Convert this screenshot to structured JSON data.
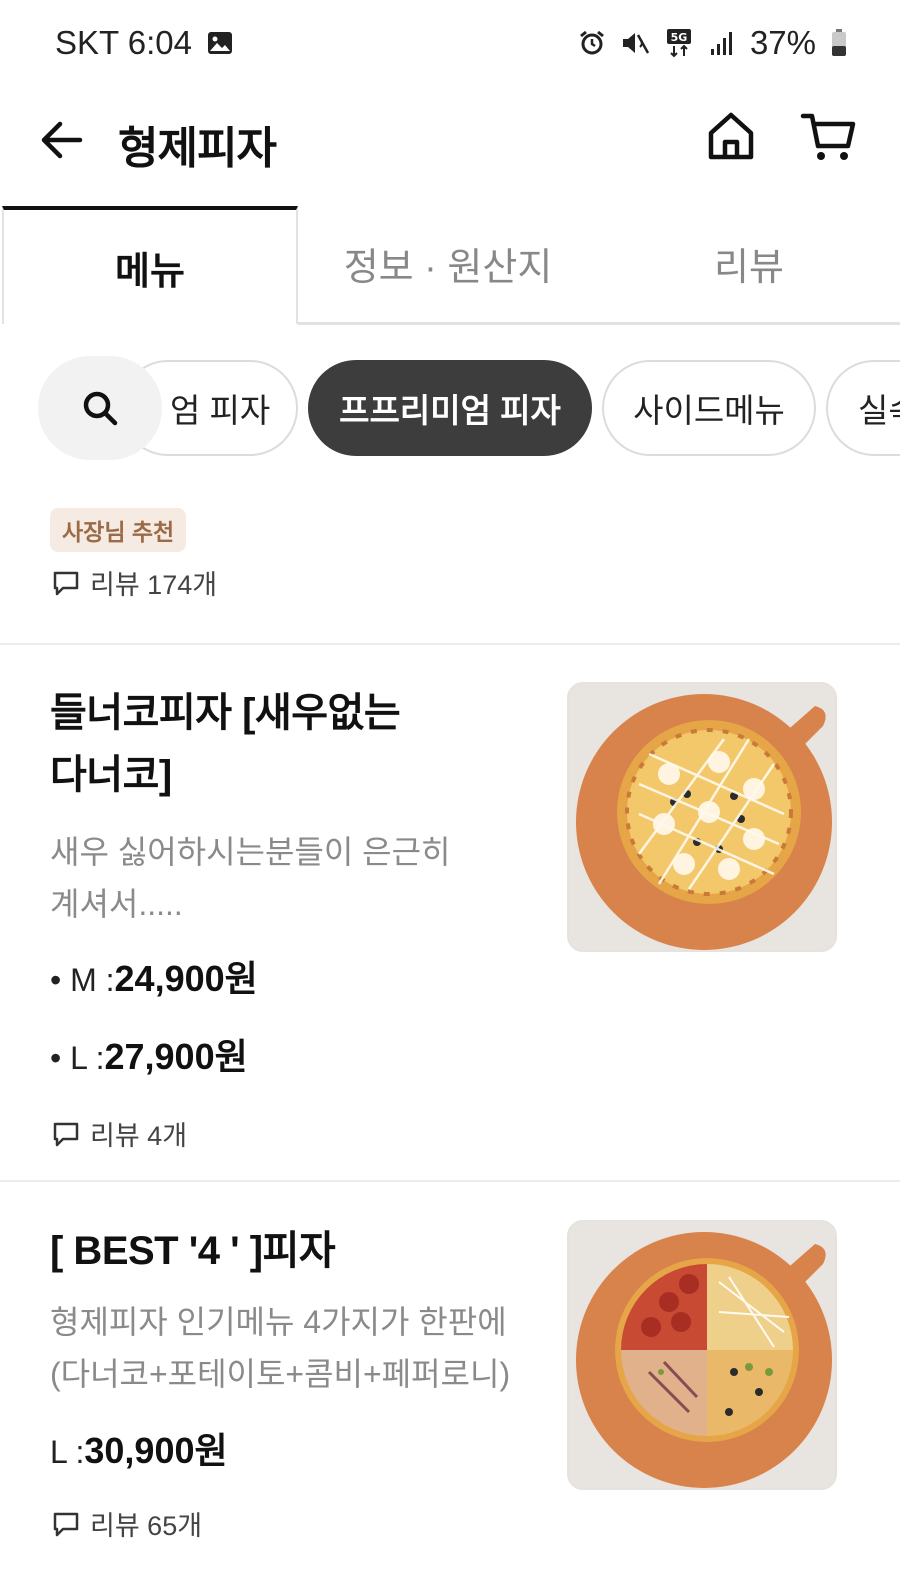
{
  "status_bar": {
    "carrier_time": "SKT 6:04",
    "battery": "37%",
    "icons": [
      "gallery-icon",
      "alarm-icon",
      "mute-icon",
      "5g-icon",
      "signal-icon",
      "battery-icon"
    ]
  },
  "app_bar": {
    "title": "형제피자",
    "icons": [
      "back-arrow-icon",
      "home-icon",
      "cart-icon"
    ]
  },
  "tabs": [
    {
      "label": "메뉴",
      "active": true
    },
    {
      "label": "정보 · 원산지",
      "active": false
    },
    {
      "label": "리뷰",
      "active": false
    }
  ],
  "chips": {
    "search_icon": "search-icon",
    "items": [
      {
        "label": "엄 피자",
        "active": false
      },
      {
        "label": "프프리미엄 피자",
        "active": true
      },
      {
        "label": "사이드메뉴",
        "active": false
      },
      {
        "label": "실속",
        "active": false
      }
    ]
  },
  "top_section": {
    "badge": "사장님 추천",
    "review": "리뷰 174개"
  },
  "menu_items": [
    {
      "name_line1": "들너코피자 [새우없는",
      "name_line2": "다너코]",
      "desc_line1": "새우 싫어하시는분들이 은근히",
      "desc_line2": "계셔서.....",
      "prices": [
        {
          "size": "• M : ",
          "value": "24,900원"
        },
        {
          "size": "• L : ",
          "value": "27,900원"
        }
      ],
      "review": "리뷰 4개"
    },
    {
      "name_line1": "[ BEST '4 ' ]피자",
      "desc_line1": "형제피자 인기메뉴 4가지가 한판에",
      "desc_line2": "(다너코+포테이토+콤비+페퍼로니)",
      "prices": [
        {
          "size": "L : ",
          "value": "30,900원"
        }
      ],
      "review": "리뷰 65개"
    }
  ],
  "colors": {
    "accent_dark": "#3d3d3d",
    "badge_bg": "#f5ebe3",
    "badge_text": "#9b6a47",
    "desc_gray": "#8a8a8a"
  }
}
